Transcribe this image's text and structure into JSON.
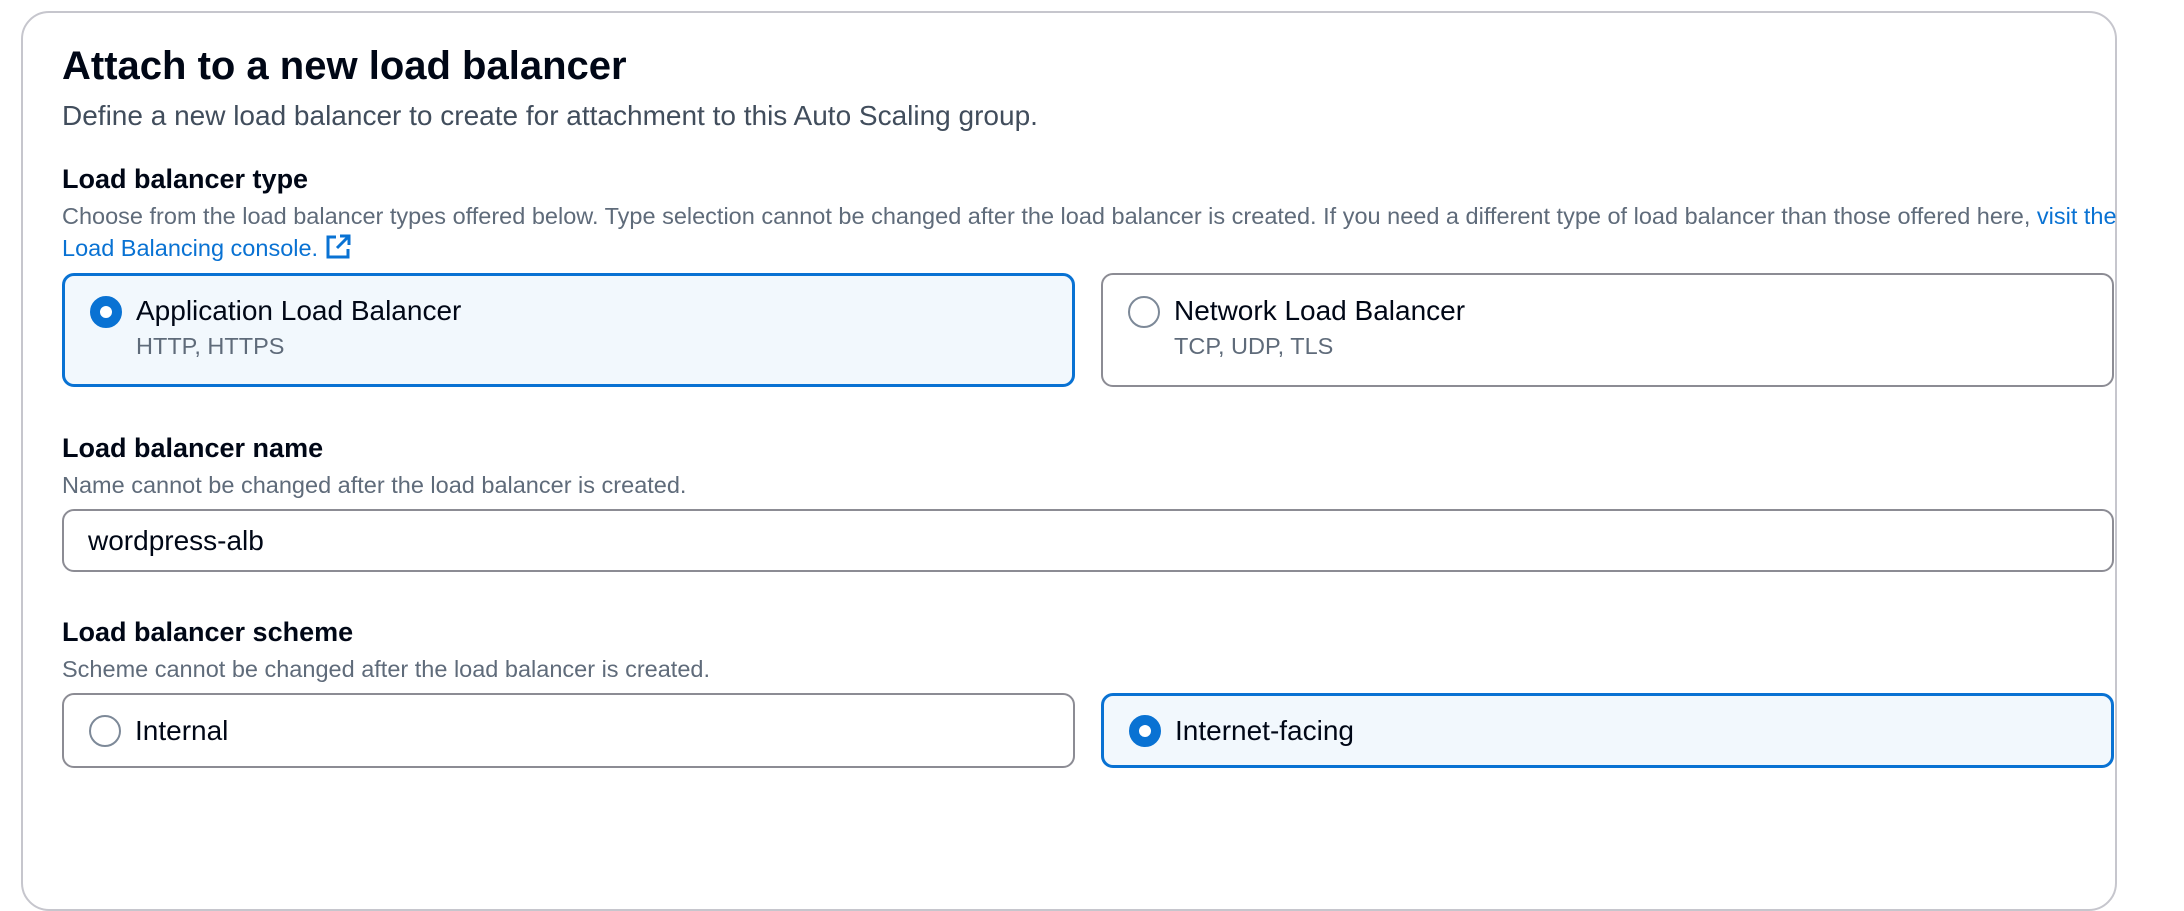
{
  "section": {
    "title": "Attach to a new load balancer",
    "subtitle": "Define a new load balancer to create for attachment to this Auto Scaling group."
  },
  "lb_type": {
    "label": "Load balancer type",
    "description": "Choose from the load balancer types offered below. Type selection cannot be changed after the load balancer is created. If you need a different type of load balancer than those offered here, ",
    "link_text": "visit the Load Balancing console.",
    "options": [
      {
        "title": "Application Load Balancer",
        "subtitle": "HTTP, HTTPS",
        "selected": true
      },
      {
        "title": "Network Load Balancer",
        "subtitle": "TCP, UDP, TLS",
        "selected": false
      }
    ]
  },
  "lb_name": {
    "label": "Load balancer name",
    "description": "Name cannot be changed after the load balancer is created.",
    "value": "wordpress-alb"
  },
  "lb_scheme": {
    "label": "Load balancer scheme",
    "description": "Scheme cannot be changed after the load balancer is created.",
    "options": [
      {
        "title": "Internal",
        "selected": false
      },
      {
        "title": "Internet-facing",
        "selected": true
      }
    ]
  },
  "colors": {
    "accent": "#0972d3",
    "selected_bg": "#f2f8fd",
    "border": "#8c8c94",
    "secondary_text": "#5f6b7a"
  }
}
